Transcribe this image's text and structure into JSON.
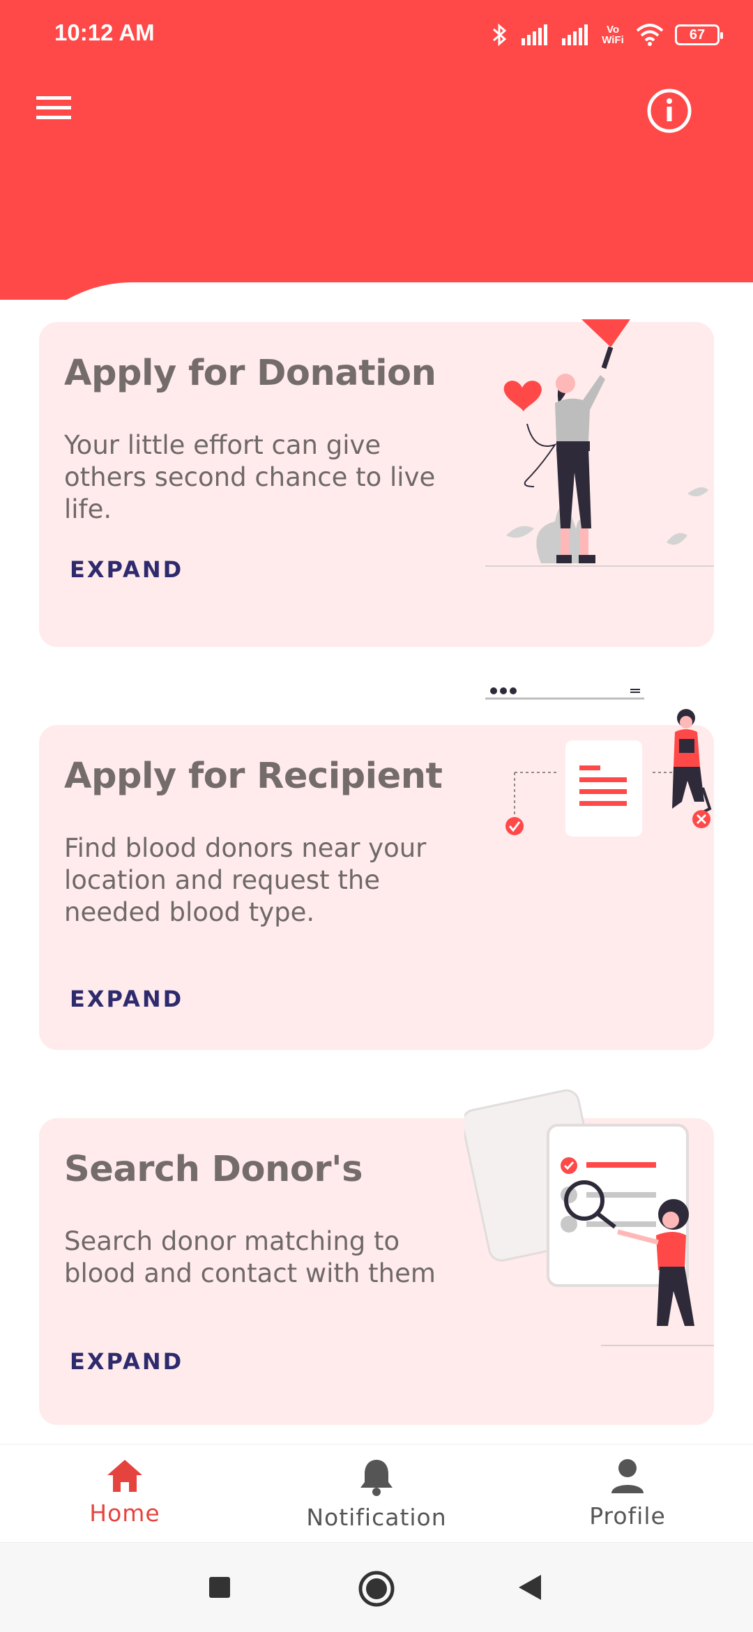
{
  "status_bar": {
    "time": "10:12 AM",
    "battery": "67",
    "wifi_label": "Vo WiFi"
  },
  "app_bar": {
    "menu_icon": "hamburger-menu-icon",
    "info_icon": "info-icon"
  },
  "cards": [
    {
      "title": "Apply for Donation",
      "description": "Your little effort can give others second chance to live life.",
      "action": "EXPAND"
    },
    {
      "title": "Apply for Recipient",
      "description": "Find blood donors near your location and request the needed blood type.",
      "action": "EXPAND"
    },
    {
      "title": "Search Donor's",
      "description": "Search donor matching to blood and contact with them",
      "action": "EXPAND"
    }
  ],
  "bottom_nav": [
    {
      "label": "Home",
      "icon": "home-icon",
      "active": true
    },
    {
      "label": "Notification",
      "icon": "bell-icon",
      "active": false
    },
    {
      "label": "Profile",
      "icon": "person-icon",
      "active": false
    }
  ],
  "colors": {
    "primary": "#ff4848",
    "card_bg": "#ffebeb",
    "expand_text": "#2e2a6e",
    "title_text": "#746b6b",
    "nav_active": "#e5433d",
    "nav_inactive": "#555555"
  }
}
